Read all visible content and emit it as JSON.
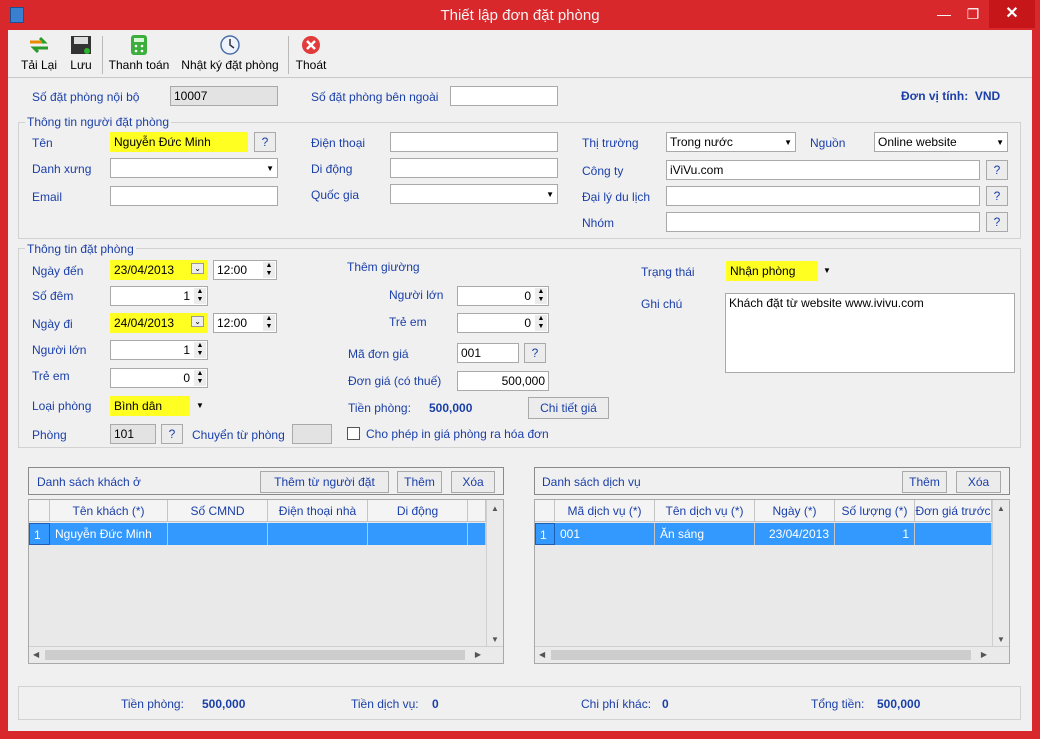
{
  "window": {
    "title": "Thiết lập đơn đặt phòng"
  },
  "toolbar": {
    "reload": "Tải Lại",
    "save": "Lưu",
    "pay": "Thanh toán",
    "log": "Nhật ký đặt phòng",
    "exit": "Thoát"
  },
  "header": {
    "internal_label": "Số đặt phòng nội bộ",
    "internal_value": "10007",
    "external_label": "Số đặt phòng bên ngoài",
    "external_value": "",
    "unit_label": "Đơn vị tính:",
    "unit_value": "VND"
  },
  "booker": {
    "group": "Thông tin người đặt phòng",
    "name_label": "Tên",
    "name": "Nguyễn Đức Minh",
    "salutation_label": "Danh xưng",
    "salutation": "",
    "email_label": "Email",
    "email": "",
    "phone_label": "Điện thoại",
    "phone": "",
    "mobile_label": "Di động",
    "mobile": "",
    "country_label": "Quốc gia",
    "country": "",
    "market_label": "Thị trường",
    "market": "Trong nước",
    "source_label": "Nguồn",
    "source": "Online website",
    "company_label": "Công ty",
    "company": "iViVu.com",
    "agent_label": "Đại lý du lịch",
    "agent": "",
    "group_label": "Nhóm",
    "group_value": ""
  },
  "booking": {
    "group": "Thông tin đặt phòng",
    "arrive_label": "Ngày đến",
    "arrive_date": "23/04/2013",
    "arrive_time": "12:00",
    "nights_label": "Số đêm",
    "nights": "1",
    "depart_label": "Ngày đi",
    "depart_date": "24/04/2013",
    "depart_time": "12:00",
    "adults_label": "Người lớn",
    "adults": "1",
    "children_label": "Trẻ em",
    "children": "0",
    "roomtype_label": "Loại phòng",
    "roomtype": "Bình dân",
    "room_label": "Phòng",
    "room": "101",
    "transfer_label": "Chuyển từ phòng",
    "transfer": "",
    "extra_bed_label": "Thêm giường",
    "extra_adults_label": "Người lớn",
    "extra_adults": "0",
    "extra_children_label": "Trẻ em",
    "extra_children": "0",
    "rate_code_label": "Mã đơn giá",
    "rate_code": "001",
    "rate_label": "Đơn giá  (có thuế)",
    "rate": "500,000",
    "room_charge_label": "Tiền phòng:",
    "room_charge": "500,000",
    "price_detail_btn": "Chi tiết giá",
    "print_label": "Cho phép in giá phòng ra hóa đơn",
    "status_label": "Trạng thái",
    "status": "Nhận phòng",
    "note_label": "Ghi chú",
    "note": "Khách đặt từ website www.ivivu.com"
  },
  "guests": {
    "title": "Danh sách khách ở",
    "add_from_booker": "Thêm từ người đặt",
    "add": "Thêm",
    "delete": "Xóa",
    "columns": [
      "Tên khách (*)",
      "Số CMND",
      "Điện thoại nhà",
      "Di động"
    ],
    "rows": [
      {
        "index": "1",
        "name": "Nguyễn Đức Minh",
        "id": "",
        "home": "",
        "mobile": ""
      }
    ]
  },
  "services": {
    "title": "Danh sách dịch vụ",
    "add": "Thêm",
    "delete": "Xóa",
    "columns": [
      "Mã dịch vụ (*)",
      "Tên dịch vụ (*)",
      "Ngày (*)",
      "Số lượng (*)",
      "Đơn giá trước"
    ],
    "rows": [
      {
        "index": "1",
        "code": "001",
        "name": "Ăn sáng",
        "date": "23/04/2013",
        "qty": "1",
        "price": ""
      }
    ]
  },
  "footer": {
    "room_label": "Tiền phòng:",
    "room": "500,000",
    "service_label": "Tiền dịch vụ:",
    "service": "0",
    "other_label": "Chi phí khác:",
    "other": "0",
    "total_label": "Tổng tiền:",
    "total": "500,000"
  }
}
